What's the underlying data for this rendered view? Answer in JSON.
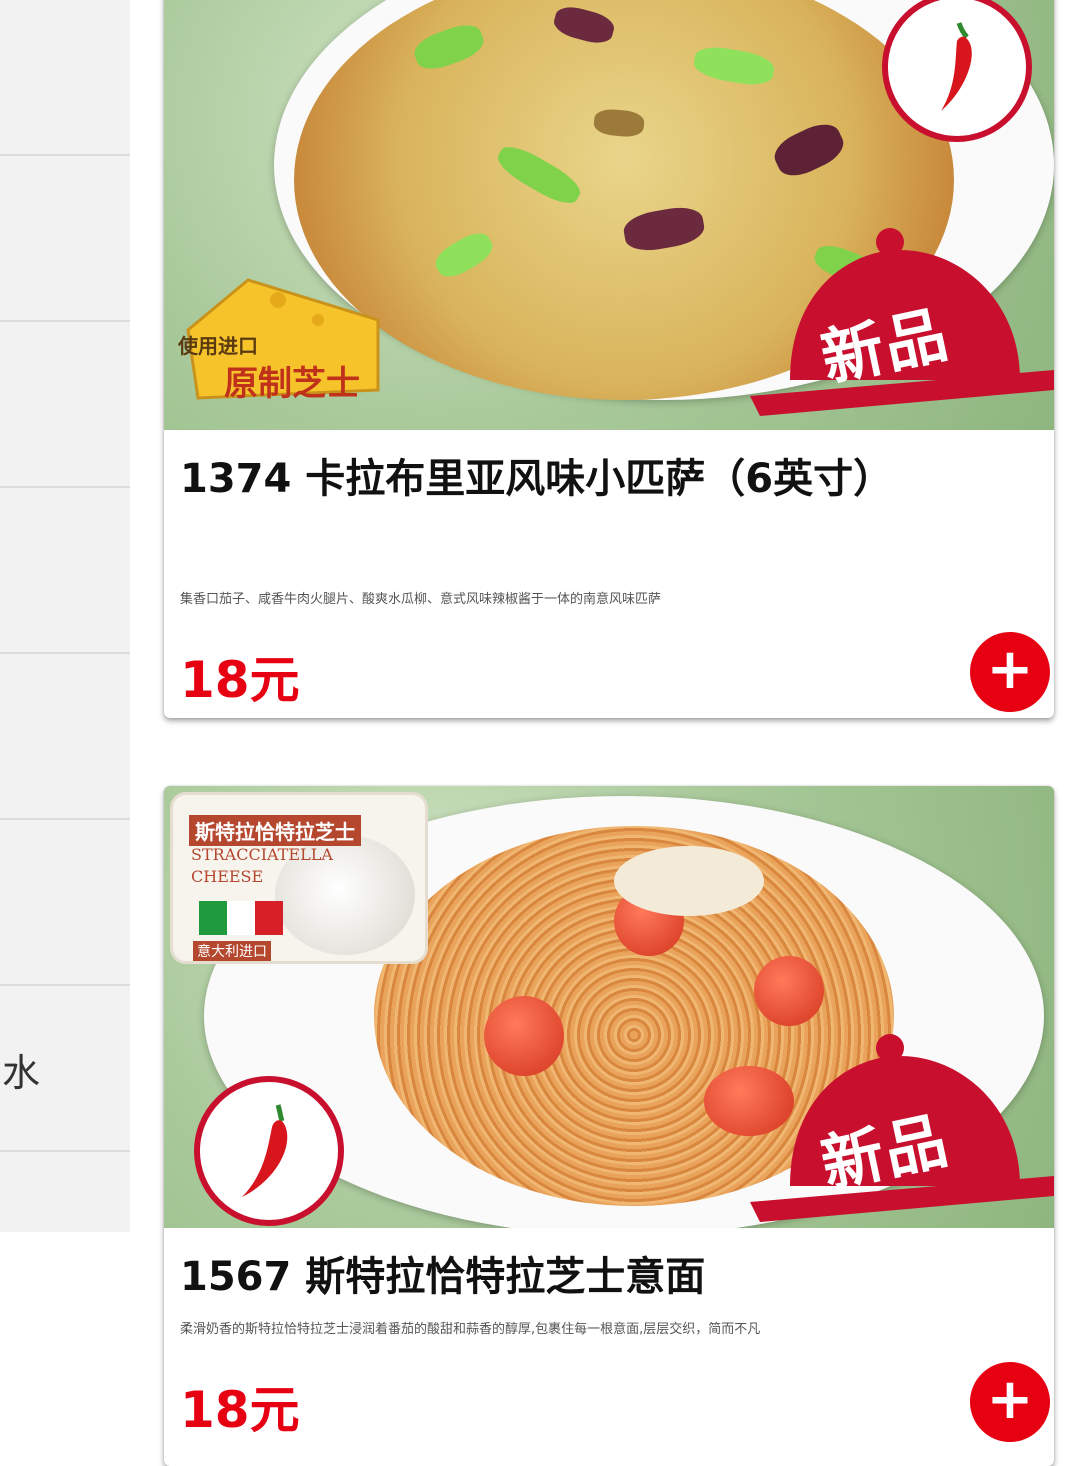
{
  "sidebar": {
    "items": [
      {
        "label": ""
      },
      {
        "label": ""
      },
      {
        "label": ""
      },
      {
        "label": ""
      },
      {
        "label": ""
      },
      {
        "label": ""
      },
      {
        "label": "水"
      },
      {
        "label": ""
      }
    ]
  },
  "products": [
    {
      "title": "1374 卡拉布里亚风味小匹萨（6英寸）",
      "description": "集香口茄子、咸香牛肉火腿片、酸爽水瓜柳、意式风味辣椒酱于一体的南意风味匹萨",
      "price": "18元",
      "new_badge": "新品",
      "cheese_badge": {
        "line1": "使用进口",
        "line2": "原制芝士"
      },
      "spicy_icon": "chili-pepper-icon",
      "add_icon": "plus-icon"
    },
    {
      "title": "1567 斯特拉恰特拉芝士意面",
      "description": "柔滑奶香的斯特拉恰特拉芝士浸润着番茄的酸甜和蒜香的醇厚,包裹住每一根意面,层层交织，简而不凡",
      "price": "18元",
      "new_badge": "新品",
      "cheese_badge": {
        "cn": "斯特拉恰特拉芝士",
        "en1": "STRACCIATELLA",
        "en2": "CHEESE",
        "origin": "意大利进口"
      },
      "spicy_icon": "chili-pepper-icon",
      "add_icon": "plus-icon"
    }
  ],
  "colors": {
    "accent": "#e60012",
    "badge_red": "#c8102e",
    "sidebar_bg": "#f2f2f2"
  }
}
